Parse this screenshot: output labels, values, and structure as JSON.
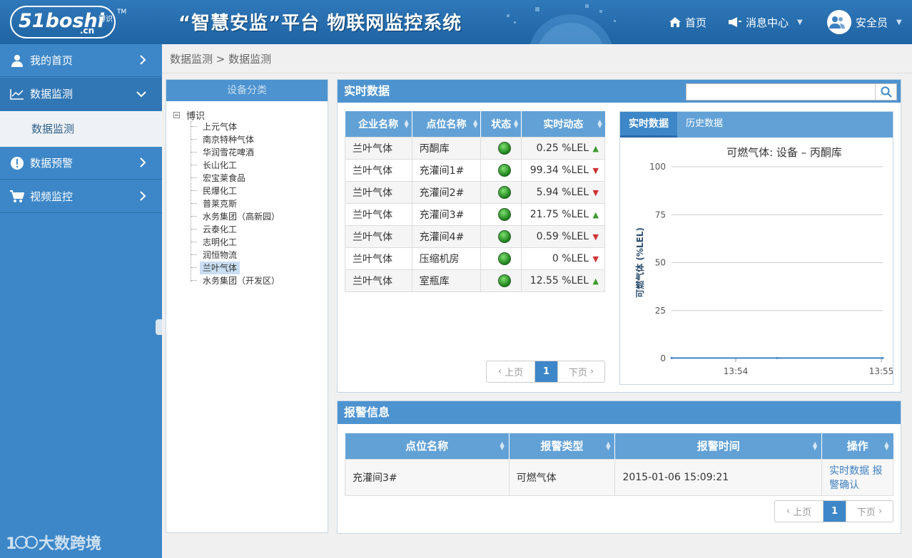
{
  "header": {
    "logo_main": "51boshi",
    "logo_cn": ".cn",
    "logo_sub": "博识",
    "logo_tm": "TM",
    "title": "“智慧安监”平台 物联网监控系统",
    "home": "首页",
    "messages": "消息中心",
    "user": "安全员"
  },
  "sidebar": {
    "items": [
      {
        "label": "我的首页"
      },
      {
        "label": "数据监测"
      },
      {
        "label": "数据预警"
      },
      {
        "label": "视频监控"
      }
    ],
    "sub_item": "数据监测",
    "watermark": "大数跨境"
  },
  "breadcrumb": "数据监测 > 数据监测",
  "tree": {
    "header": "设备分类",
    "root": "博识",
    "nodes": [
      "上元气体",
      "南京特种气体",
      "华润雪花啤酒",
      "长山化工",
      "宏宝莱食品",
      "民爆化工",
      "普莱克斯",
      "水务集团（高新园）",
      "云泰化工",
      "志明化工",
      "润恒物流",
      "兰叶气体",
      "水务集团（开发区）"
    ],
    "selected": "兰叶气体"
  },
  "realtime": {
    "title": "实时数据",
    "search_placeholder": "",
    "columns": [
      "企业名称",
      "点位名称",
      "状态",
      "实时动态"
    ],
    "rows": [
      {
        "company": "兰叶气体",
        "point": "丙酮库",
        "value": "0.25 %LEL",
        "trend": "up"
      },
      {
        "company": "兰叶气体",
        "point": "充灌间1#",
        "value": "99.34 %LEL",
        "trend": "down"
      },
      {
        "company": "兰叶气体",
        "point": "充灌间2#",
        "value": "5.94 %LEL",
        "trend": "down"
      },
      {
        "company": "兰叶气体",
        "point": "充灌间3#",
        "value": "21.75 %LEL",
        "trend": "up"
      },
      {
        "company": "兰叶气体",
        "point": "充灌间4#",
        "value": "0.59 %LEL",
        "trend": "down"
      },
      {
        "company": "兰叶气体",
        "point": "压缩机房",
        "value": "0 %LEL",
        "trend": "down"
      },
      {
        "company": "兰叶气体",
        "point": "室瓶库",
        "value": "12.55 %LEL",
        "trend": "up"
      }
    ],
    "pager": {
      "prev": "上页",
      "page": "1",
      "next": "下页"
    }
  },
  "chart_tabs": {
    "realtime": "实时数据",
    "history": "历史数据"
  },
  "chart_data": {
    "type": "line",
    "title": "可燃气体: 设备 – 丙酮库",
    "ylabel": "可燃气体 (%LEL)",
    "ylim": [
      0,
      100
    ],
    "yticks": [
      0,
      25,
      50,
      75,
      100
    ],
    "xticks": [
      "13:54",
      "13:55"
    ],
    "series": [
      {
        "values": [
          0.25,
          0.25,
          0.25
        ]
      }
    ]
  },
  "alarm": {
    "title": "报警信息",
    "columns": [
      "点位名称",
      "报警类型",
      "报警时间",
      "操作"
    ],
    "rows": [
      {
        "point": "充灌间3#",
        "type": "可燃气体",
        "time": "2015-01-06 15:09:21",
        "action": "实时数据 报警确认"
      }
    ],
    "pager": {
      "prev": "上页",
      "page": "1",
      "next": "下页"
    }
  },
  "colors": {
    "header": "#2a6fb0",
    "sidebar": "#3d87c8",
    "panel_head": "#4d93d0"
  }
}
